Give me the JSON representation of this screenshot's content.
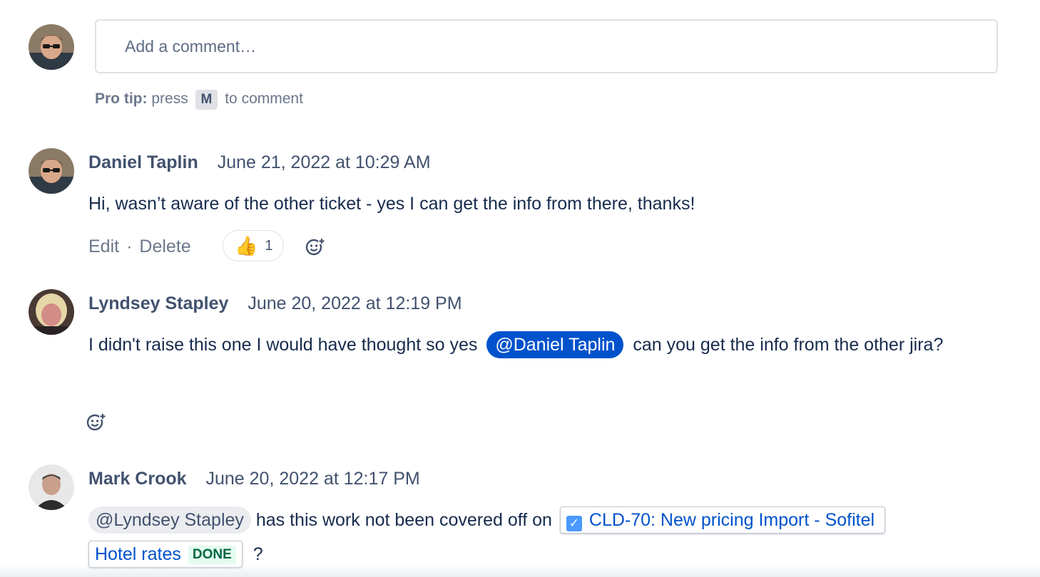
{
  "composer": {
    "placeholder": "Add a comment…",
    "protip_bold": "Pro tip:",
    "protip_pre": "press",
    "protip_key": "M",
    "protip_post": "to comment"
  },
  "comments": [
    {
      "author": "Daniel Taplin",
      "timestamp": "June 21, 2022 at 10:29 AM",
      "text": "Hi, wasn’t aware of the other ticket - yes I can get the info from there, thanks!",
      "edit_label": "Edit",
      "delete_label": "Delete",
      "reaction_count": "1"
    },
    {
      "author": "Lyndsey Stapley",
      "timestamp": "June 20, 2022 at 12:19 PM",
      "text_before": "I didn't raise this one I would have thought so yes",
      "mention": "@Daniel Taplin",
      "text_after": "can you get the info from the other jira?"
    },
    {
      "author": "Mark Crook",
      "timestamp": "June 20, 2022 at 12:17 PM",
      "mention": "@Lyndsey Stapley",
      "text_middle": "has this work not been covered off on",
      "issue_part1": "CLD-70: New pricing Import - Sofitel",
      "issue_part2": "Hotel rates",
      "issue_status": "DONE",
      "text_end": "?"
    }
  ],
  "colors": {
    "mention_self_bg": "#0052cc",
    "link": "#0052cc",
    "done_bg": "#e3fcef",
    "done_text": "#006644"
  },
  "icons": [
    "user-avatar",
    "thumbs-up-icon",
    "add-reaction-icon",
    "checkbox-icon"
  ]
}
